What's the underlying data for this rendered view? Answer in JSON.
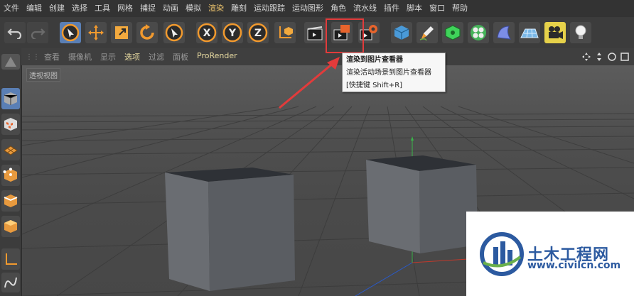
{
  "menu": [
    "文件",
    "编辑",
    "创建",
    "选择",
    "工具",
    "网格",
    "捕捉",
    "动画",
    "模拟",
    "渲染",
    "雕刻",
    "运动跟踪",
    "运动图形",
    "角色",
    "流水线",
    "插件",
    "脚本",
    "窗口",
    "帮助"
  ],
  "menu_highlight_index": 9,
  "toolbar": {
    "undo": "undo-icon",
    "redo": "redo-icon",
    "select": "live-selection-icon",
    "move": "move-icon",
    "scale": "scale-icon",
    "rotate": "rotate-icon",
    "last": "last-tool-icon",
    "x_label": "X",
    "y_label": "Y",
    "z_label": "Z",
    "coord": "coordinate-system-icon",
    "render_view": "render-view-icon",
    "render_picture": "render-to-picture-viewer-icon",
    "render_settings": "render-settings-icon",
    "cube": "cube-icon",
    "pen": "pen-icon",
    "subdivision": "subdivision-icon",
    "cloner": "cloner-icon",
    "deformer": "deformer-icon",
    "floor": "floor-icon",
    "camera": "camera-icon",
    "light": "light-icon"
  },
  "viewbar": {
    "items": [
      "查看",
      "摄像机",
      "显示",
      "选项",
      "过滤",
      "面板",
      "ProRender"
    ],
    "active_index": 3
  },
  "viewport": {
    "label": "透视视图"
  },
  "tooltip": {
    "title": "渲染到图片查看器",
    "description": "渲染活动场景到图片查看器",
    "shortcut": "[快捷键 Shift+R]"
  },
  "watermark": {
    "title": "土木工程网",
    "url": "www.civilcn.com"
  },
  "colors": {
    "accent": "#f0c66e",
    "highlight_box": "#e23b3b",
    "watermark_blue": "#2c5aa0",
    "menubar": "#333333",
    "toolbar": "#3c3c3c"
  }
}
